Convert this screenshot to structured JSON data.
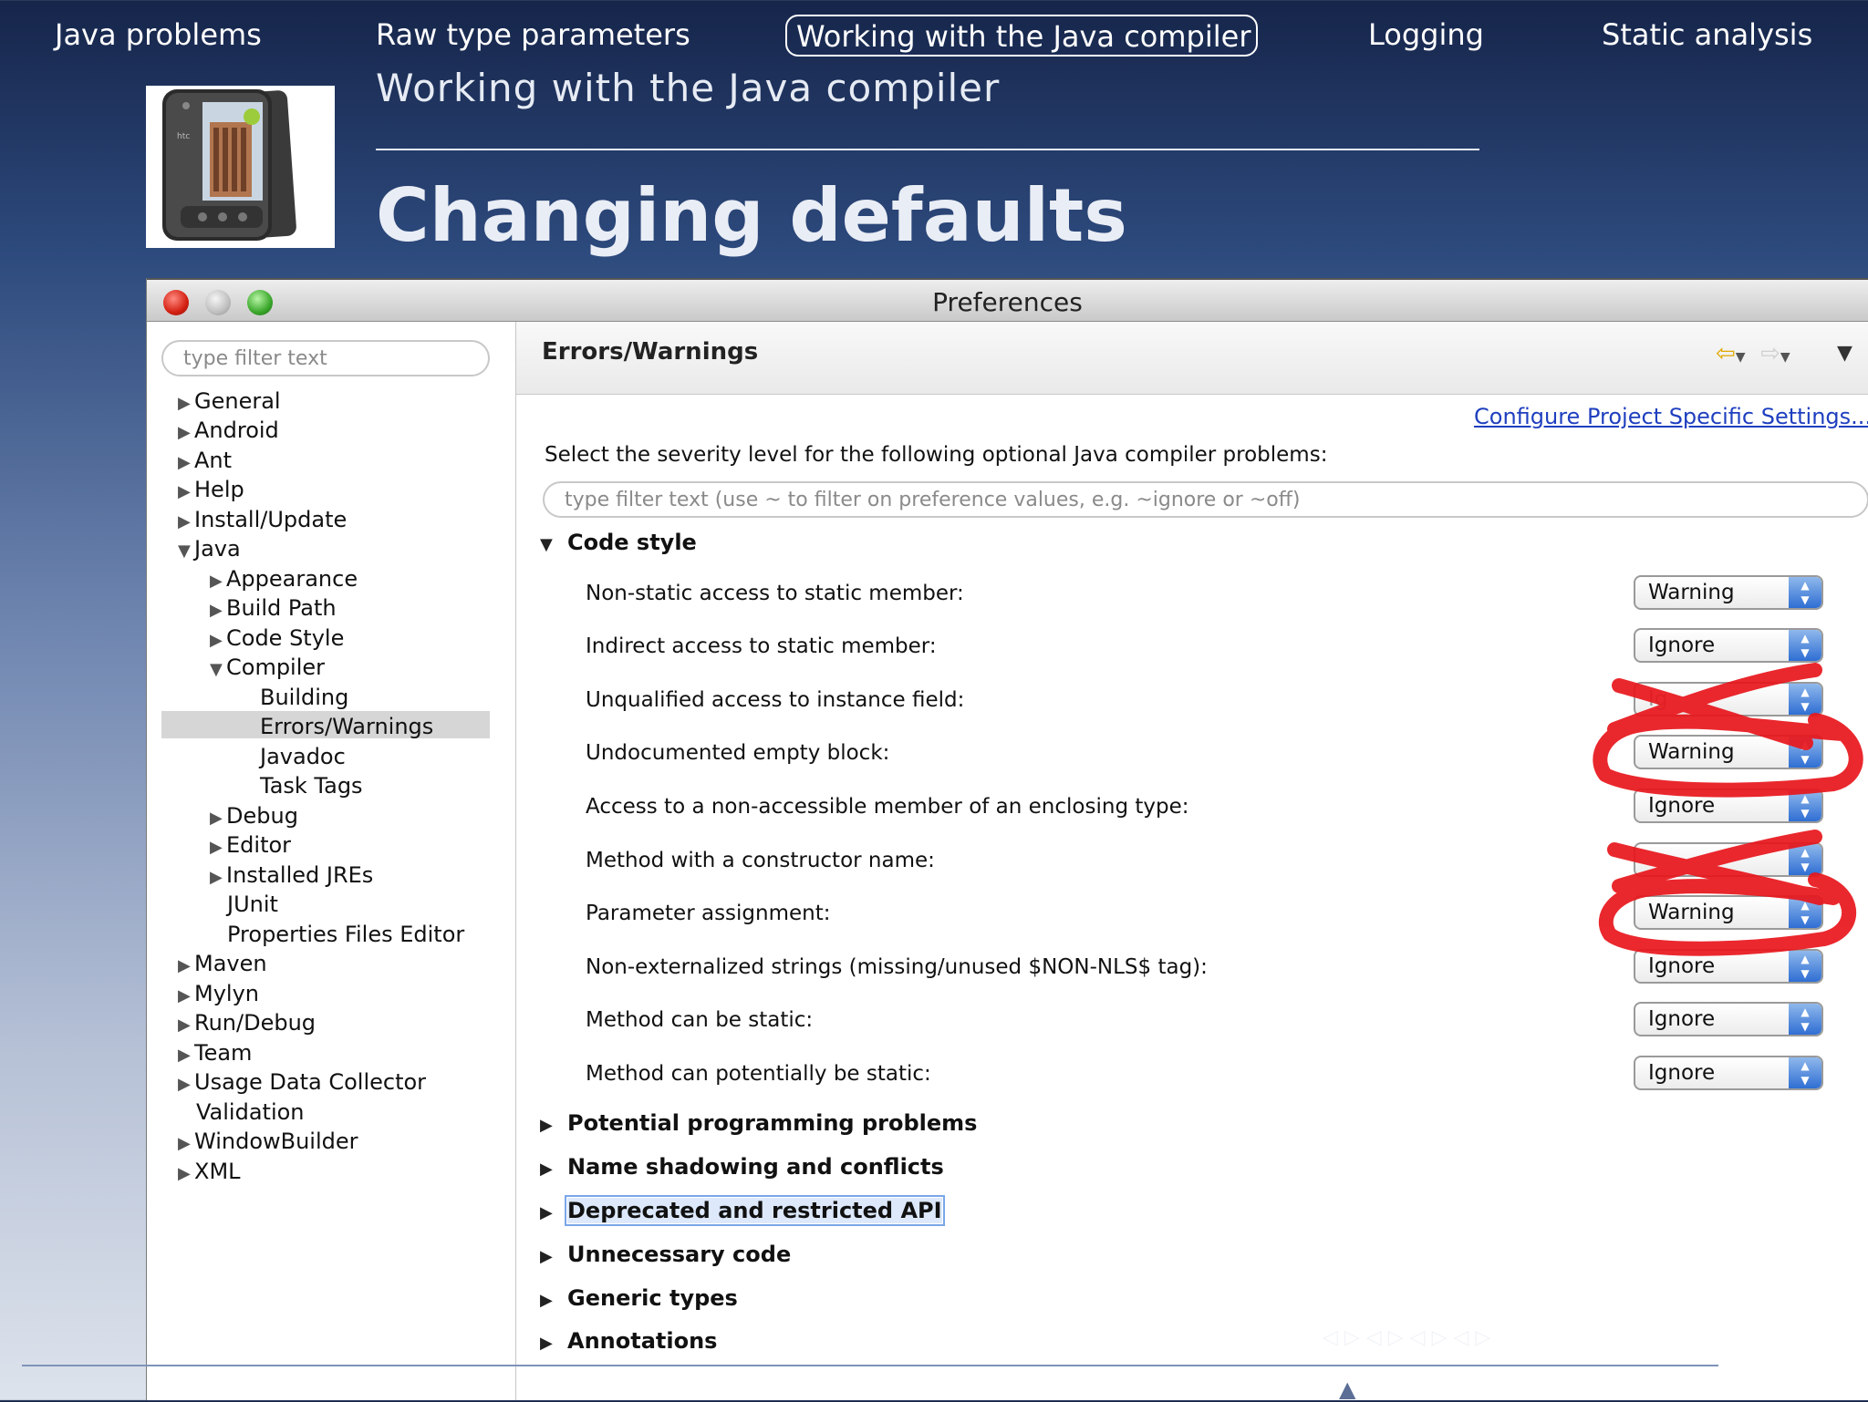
{
  "nav": {
    "items": [
      {
        "label": "Java problems"
      },
      {
        "label": "Raw type parameters"
      },
      {
        "label": "Working with the Java compiler"
      },
      {
        "label": "Logging"
      },
      {
        "label": "Static analysis"
      }
    ]
  },
  "header": {
    "subtitle": "Working with the Java compiler",
    "title": "Changing defaults"
  },
  "window": {
    "title": "Preferences",
    "filter_placeholder": "type filter text",
    "tree": [
      {
        "label": "General"
      },
      {
        "label": "Android"
      },
      {
        "label": "Ant"
      },
      {
        "label": "Help"
      },
      {
        "label": "Install/Update"
      },
      {
        "label": "Java"
      },
      {
        "label": "Appearance"
      },
      {
        "label": "Build Path"
      },
      {
        "label": "Code Style"
      },
      {
        "label": "Compiler"
      },
      {
        "label": "Building"
      },
      {
        "label": "Errors/Warnings"
      },
      {
        "label": "Javadoc"
      },
      {
        "label": "Task Tags"
      },
      {
        "label": "Debug"
      },
      {
        "label": "Editor"
      },
      {
        "label": "Installed JREs"
      },
      {
        "label": "JUnit"
      },
      {
        "label": "Properties Files Editor"
      },
      {
        "label": "Maven"
      },
      {
        "label": "Mylyn"
      },
      {
        "label": "Run/Debug"
      },
      {
        "label": "Team"
      },
      {
        "label": "Usage Data Collector"
      },
      {
        "label": "Validation"
      },
      {
        "label": "WindowBuilder"
      },
      {
        "label": "XML"
      }
    ],
    "pane": {
      "title": "Errors/Warnings",
      "config_link": "Configure Project Specific Settings...",
      "severity_label": "Select the severity level for the following optional Java compiler problems:",
      "filter_placeholder": "type filter text (use ~ to filter on preference values, e.g. ~ignore or ~off)",
      "code_style_section": "Code style",
      "options": [
        {
          "label": "Non-static access to static member:",
          "value": "Warning"
        },
        {
          "label": "Indirect access to static member:",
          "value": "Ignore"
        },
        {
          "label": "Unqualified access to instance field:",
          "value": "Ig"
        },
        {
          "label": "Undocumented empty block:",
          "value": "Warning"
        },
        {
          "label": "Access to a non-accessible member of an enclosing type:",
          "value": "Ignore"
        },
        {
          "label": "Method with a constructor name:",
          "value": ""
        },
        {
          "label": "Parameter assignment:",
          "value": "Warning"
        },
        {
          "label": "Non-externalized strings (missing/unused $NON-NLS$ tag):",
          "value": "Ignore"
        },
        {
          "label": "Method can be static:",
          "value": "Ignore"
        },
        {
          "label": "Method can potentially be static:",
          "value": "Ignore"
        }
      ],
      "sections": [
        {
          "label": "Potential programming problems"
        },
        {
          "label": "Name shadowing and conflicts"
        },
        {
          "label": "Deprecated and restricted API"
        },
        {
          "label": "Unnecessary code"
        },
        {
          "label": "Generic types"
        },
        {
          "label": "Annotations"
        }
      ]
    }
  },
  "colors": {
    "scribble": "#e8161c",
    "select_arrow": "#2f6ed3",
    "link": "#1f3fbf"
  }
}
